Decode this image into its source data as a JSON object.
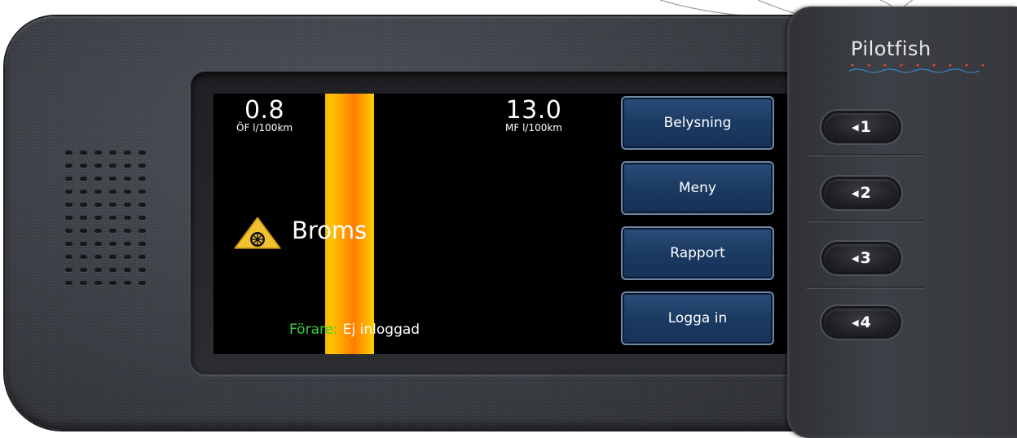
{
  "device": {
    "brand": "Pilotfish"
  },
  "screen": {
    "left_reading": {
      "value": "0.8",
      "unit": "ÖF l/100km"
    },
    "right_reading": {
      "value": "13.0",
      "unit": "MF l/100km"
    },
    "warning": {
      "icon": "brake-warning-icon",
      "label": "Broms"
    },
    "driver": {
      "label": "Förare:",
      "value": "Ej inloggad"
    },
    "soft_buttons": [
      {
        "label": "Belysning"
      },
      {
        "label": "Meny"
      },
      {
        "label": "Rapport"
      },
      {
        "label": "Logga in"
      }
    ]
  },
  "hardware_buttons": [
    {
      "number": "1"
    },
    {
      "number": "2"
    },
    {
      "number": "3"
    },
    {
      "number": "4"
    }
  ],
  "colors": {
    "screen_bg": "#000000",
    "button_blue": "#1b3a62",
    "driver_label": "#38d03a",
    "bar_orange": "#ff8c00",
    "warning_yellow": "#f2c12e"
  }
}
